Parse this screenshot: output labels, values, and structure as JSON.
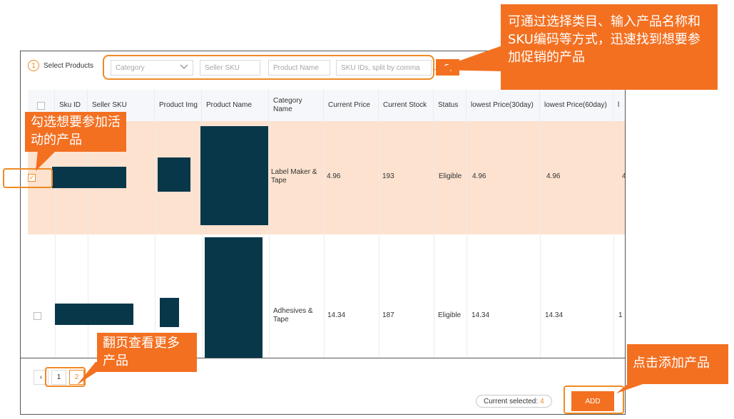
{
  "step": {
    "number": "1",
    "label": "Select Products"
  },
  "filters": {
    "category_placeholder": "Category",
    "seller_sku_placeholder": "Seller SKU",
    "product_name_placeholder": "Product Name",
    "sku_ids_placeholder": "SKU IDs, split by comma"
  },
  "table": {
    "headers": [
      "Sku ID",
      "Seller SKU",
      "Product Img",
      "Product Name",
      "Category Name",
      "Current Price",
      "Current Stock",
      "Status",
      "lowest Price(30day)",
      "lowest Price(60day)",
      "l"
    ],
    "rows": [
      {
        "category": "Label Maker & Tape",
        "current_price": "4.96",
        "current_stock": "193",
        "status": "Eligible",
        "low30": "4.96",
        "low60": "4.96",
        "extra": "4",
        "checked": true
      },
      {
        "category": "Adhesives & Tape",
        "current_price": "14.34",
        "current_stock": "187",
        "status": "Eligible",
        "low30": "14.34",
        "low60": "14.34",
        "extra": "1",
        "checked": false
      }
    ]
  },
  "pagination": {
    "prev": "‹",
    "pages": [
      "1",
      "2"
    ],
    "active_page": "2"
  },
  "footer": {
    "current_selected_label": "Current selected:",
    "current_selected_count": "4",
    "add_label": "ADD"
  },
  "callouts": {
    "search_tip": "可通过选择类目、输入产品名称和SKU编码等方式，迅速找到想要参加促销的产品",
    "select_tip": "勾选想要参加活动的产品",
    "page_tip": "翻页查看更多产品",
    "add_tip": "点击添加产品"
  },
  "colors": {
    "accent": "#f37021",
    "selected_row": "#fce2cf",
    "redaction": "#08374a"
  },
  "icons": {
    "search": "search-icon",
    "dropdown": "chevron-down-icon",
    "check": "checkmark-icon"
  }
}
